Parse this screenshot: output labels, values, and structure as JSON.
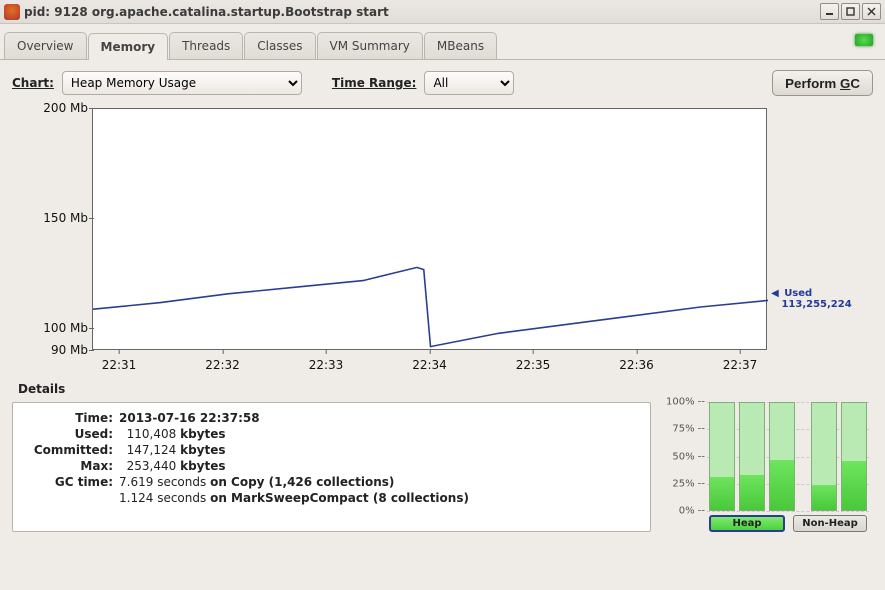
{
  "window": {
    "title": "pid: 9128 org.apache.catalina.startup.Bootstrap start"
  },
  "tabs": {
    "overview": "Overview",
    "memory": "Memory",
    "threads": "Threads",
    "classes": "Classes",
    "vmsummary": "VM Summary",
    "mbeans": "MBeans",
    "active": "memory"
  },
  "controls": {
    "chart_label": "Chart:",
    "chart_value": "Heap Memory Usage",
    "range_label": "Time Range:",
    "range_value": "All",
    "gc_prefix": "Perform ",
    "gc_u": "G",
    "gc_suffix": "C"
  },
  "chart_data": {
    "type": "line",
    "title": "",
    "xlabel": "",
    "ylabel": "",
    "ylim": [
      90,
      200
    ],
    "yticks": [
      90,
      100,
      150,
      200
    ],
    "ytick_labels": [
      "90 Mb",
      "100 Mb",
      "150 Mb",
      "200 Mb"
    ],
    "x_categories": [
      "22:31",
      "22:32",
      "22:33",
      "22:34",
      "22:35",
      "22:36",
      "22:37"
    ],
    "series": [
      {
        "name": "Used",
        "x": [
          0.0,
          0.1,
          0.2,
          0.3,
          0.4,
          0.48,
          0.49,
          0.5,
          0.6,
          0.7,
          0.8,
          0.9,
          1.0
        ],
        "y": [
          109,
          112,
          116,
          119,
          122,
          128,
          127,
          92,
          98,
          102,
          106,
          110,
          113
        ]
      }
    ],
    "current_label": "Used",
    "current_value": "113,255,224"
  },
  "details": {
    "title": "Details",
    "time_k": "Time:",
    "time_v": "2013-07-16 22:37:58",
    "used_k": "Used:",
    "used_num": "110,408",
    "used_unit": "kbytes",
    "comm_k": "Committed:",
    "comm_num": "147,124",
    "comm_unit": "kbytes",
    "max_k": "Max:",
    "max_num": "253,440",
    "max_unit": "kbytes",
    "gc_k": "GC time:",
    "gc1_a": "7.619",
    "gc1_b": "seconds",
    "gc1_c": "on Copy (1,426 collections)",
    "gc2_a": "1.124",
    "gc2_b": "seconds",
    "gc2_c": "on MarkSweepCompact (8 collections)"
  },
  "bars": {
    "pct": [
      "100% --",
      "75% --",
      "50% --",
      "25% --",
      "0% --"
    ],
    "heap_pcts": [
      31,
      33,
      47
    ],
    "nonheap_pcts": [
      23,
      46
    ],
    "heap_label": "Heap",
    "nonheap_label": "Non-Heap"
  }
}
